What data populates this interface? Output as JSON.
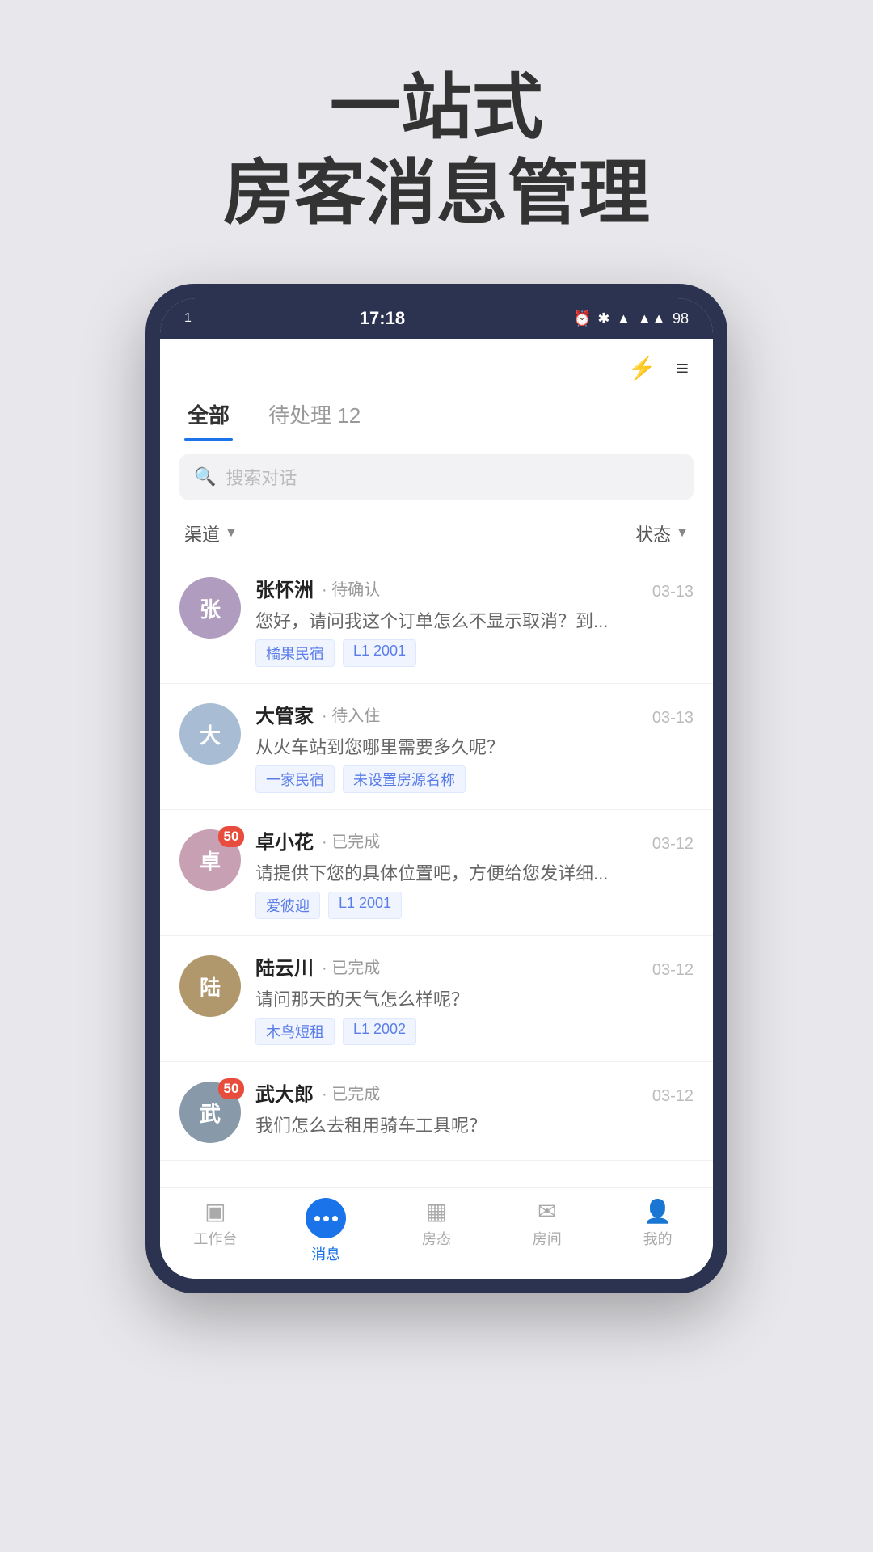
{
  "header": {
    "line1": "一站式",
    "line2": "房客消息管理"
  },
  "status_bar": {
    "indicator": "1",
    "time": "17:18",
    "icons": "⏰ ❄ ▲ ▲▲ 98"
  },
  "tabs": [
    {
      "label": "全部",
      "active": true
    },
    {
      "label": "待处理 12",
      "active": false
    }
  ],
  "search": {
    "placeholder": "搜索对话"
  },
  "filters": {
    "channel_label": "渠道",
    "status_label": "状态"
  },
  "conversations": [
    {
      "name": "张怀洲",
      "status": "· 待确认",
      "time": "03-13",
      "message": "您好，请问我这个订单怎么不显示取消？到...",
      "tags": [
        "橘果民宿",
        "L1 2001"
      ],
      "badge": null,
      "avatar_color": "#b09cbf"
    },
    {
      "name": "大管家",
      "status": "· 待入住",
      "time": "03-13",
      "message": "从火车站到您哪里需要多久呢？",
      "tags": [
        "一家民宿",
        "未设置房源名称"
      ],
      "badge": null,
      "avatar_color": "#a8bdd4"
    },
    {
      "name": "卓小花",
      "status": "· 已完成",
      "time": "03-12",
      "message": "请提供下您的具体位置吧，方便给您发详细...",
      "tags": [
        "爱彼迎",
        "L1 2001"
      ],
      "badge": "50",
      "avatar_color": "#c8a0b4"
    },
    {
      "name": "陆云川",
      "status": "· 已完成",
      "time": "03-12",
      "message": "请问那天的天气怎么样呢？",
      "tags": [
        "木鸟短租",
        "L1 2002"
      ],
      "badge": null,
      "avatar_color": "#b0986c"
    },
    {
      "name": "武大郎",
      "status": "· 已完成",
      "time": "03-12",
      "message": "我们怎么去租用骑车工具呢？",
      "tags": [],
      "badge": "50",
      "avatar_color": "#8899aa"
    }
  ],
  "bottom_nav": [
    {
      "label": "工作台",
      "icon": "🗂",
      "active": false
    },
    {
      "label": "消息",
      "icon": "dots",
      "active": true
    },
    {
      "label": "房态",
      "icon": "📅",
      "active": false
    },
    {
      "label": "房间",
      "icon": "✉",
      "active": false
    },
    {
      "label": "我的",
      "icon": "👤",
      "active": false
    }
  ]
}
